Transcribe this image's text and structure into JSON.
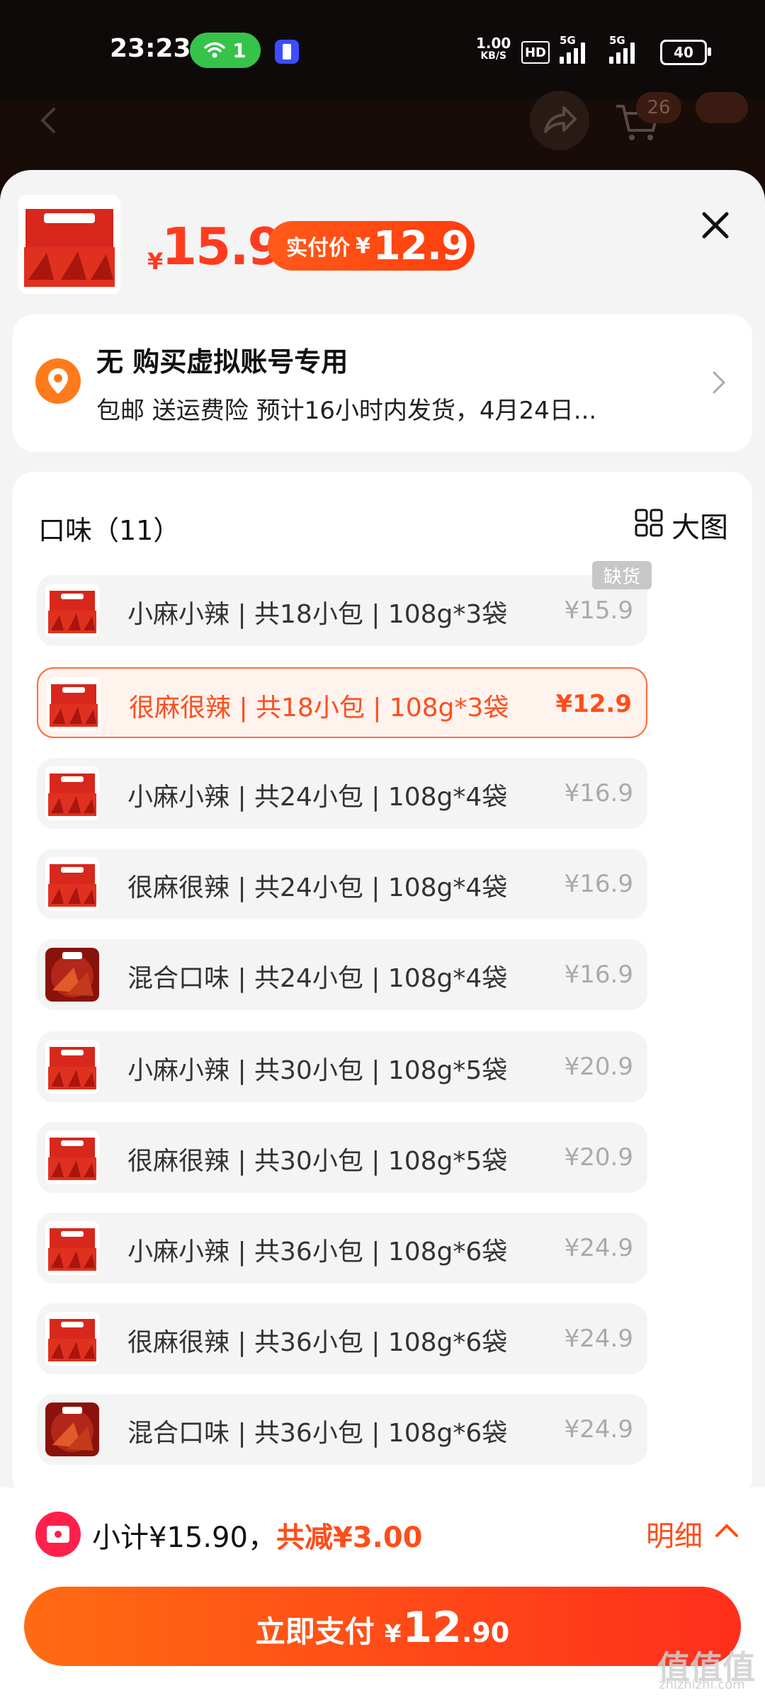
{
  "status_bar": {
    "time": "23:23",
    "wifi_count": "1",
    "speed_top": "1.00",
    "speed_bottom": "KB/S",
    "hd_label": "HD",
    "sig1_label": "5G",
    "sig2_label": "5G",
    "battery": "40"
  },
  "header": {
    "cart_badge": "26"
  },
  "product": {
    "currency": "¥",
    "price": "15.9",
    "real_price_label": "实付价",
    "real_price_currency": "¥",
    "real_price": "12.9"
  },
  "address": {
    "title": "无 购买虚拟账号专用",
    "subtitle": "包邮 送运费险 预计16小时内发货，4月24日..."
  },
  "options": {
    "header": "口味（11）",
    "big_view_label": "大图",
    "out_of_stock_label": "缺货",
    "items": [
      {
        "name": "小麻小辣 | 共18小包 | 108g*3袋",
        "price": "¥15.9"
      },
      {
        "name": "很麻很辣 | 共18小包 | 108g*3袋",
        "price": "¥12.9"
      },
      {
        "name": "小麻小辣 | 共24小包 | 108g*4袋",
        "price": "¥16.9"
      },
      {
        "name": "很麻很辣 | 共24小包 | 108g*4袋",
        "price": "¥16.9"
      },
      {
        "name": "混合口味 | 共24小包 | 108g*4袋",
        "price": "¥16.9"
      },
      {
        "name": "小麻小辣 | 共30小包 | 108g*5袋",
        "price": "¥20.9"
      },
      {
        "name": "很麻很辣 | 共30小包 | 108g*5袋",
        "price": "¥20.9"
      },
      {
        "name": "小麻小辣 | 共36小包 | 108g*6袋",
        "price": "¥24.9"
      },
      {
        "name": "很麻很辣 | 共36小包 | 108g*6袋",
        "price": "¥24.9"
      },
      {
        "name": "混合口味 | 共36小包 | 108g*6袋",
        "price": "¥24.9"
      }
    ]
  },
  "bottom": {
    "subtotal": "小计¥15.90，",
    "discount": "共减¥3.00",
    "detail_label": "明细",
    "pay_label": "立即支付",
    "pay_currency": "¥",
    "pay_int": "12",
    "pay_dec": ".90"
  },
  "watermark": {
    "main": "值值值",
    "sub": "zhizhizhi.com"
  },
  "colors": {
    "accent": "#ff4d1a",
    "button_start": "#ff6b12",
    "button_end": "#ff2e1c",
    "wifi_pill": "#35c34a"
  }
}
